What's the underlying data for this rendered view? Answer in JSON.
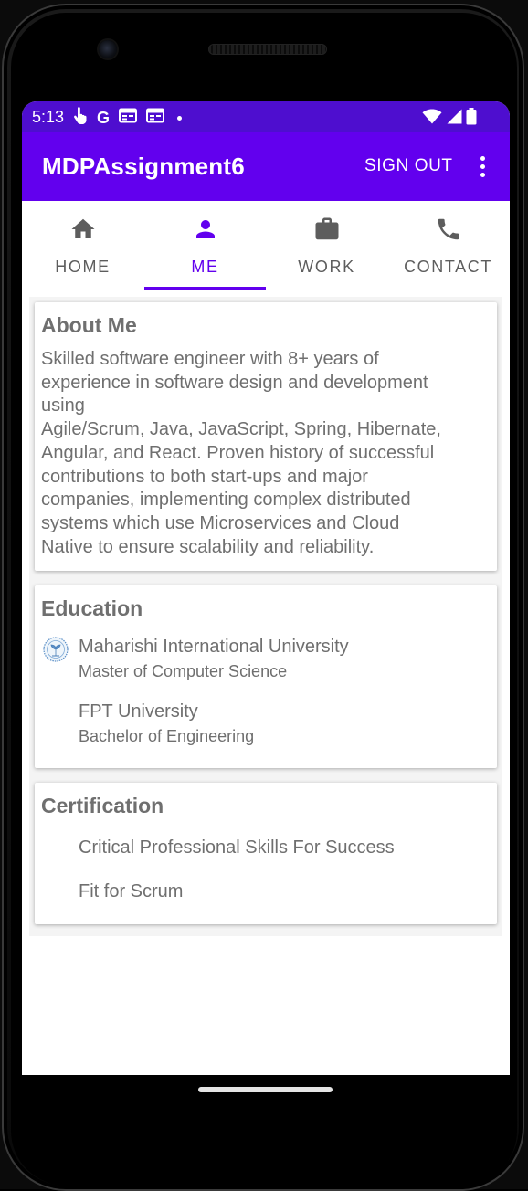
{
  "status_bar": {
    "time": "5:13",
    "left_icons": [
      "touch-icon",
      "google-icon",
      "calendar-icon",
      "calendar-icon",
      "notification-dot-icon"
    ],
    "right_icons": [
      "wifi-icon",
      "cell-signal-icon",
      "battery-icon"
    ],
    "google_letter": "G",
    "color": "#4e0ecf"
  },
  "app_bar": {
    "title": "MDPAssignment6",
    "sign_out_label": "SIGN OUT",
    "menu_icon": "more-vert-icon",
    "color": "#6200ee"
  },
  "tabs": [
    {
      "label": "HOME",
      "icon": "home-icon",
      "active": false
    },
    {
      "label": "ME",
      "icon": "person-icon",
      "active": true
    },
    {
      "label": "WORK",
      "icon": "work-icon",
      "active": false
    },
    {
      "label": "CONTACT",
      "icon": "phone-icon",
      "active": false
    }
  ],
  "about": {
    "title": "About Me",
    "lines": [
      "Skilled software engineer with 8+ years of",
      "experience in software design and development",
      "using",
      "Agile/Scrum, Java, JavaScript, Spring, Hibernate,",
      "Angular, and React. Proven history of successful",
      "contributions to both start-ups and major",
      "companies, implementing complex distributed",
      "systems which use Microservices and Cloud",
      "Native to ensure scalability and reliability."
    ]
  },
  "education": {
    "title": "Education",
    "items": [
      {
        "name": "Maharishi International University",
        "degree": "Master of Computer Science",
        "logo": "university-logo-icon"
      },
      {
        "name": "FPT University",
        "degree": "Bachelor of Engineering"
      }
    ]
  },
  "certification": {
    "title": "Certification",
    "items": [
      "Critical Professional Skills For Success",
      "Fit for Scrum"
    ]
  }
}
